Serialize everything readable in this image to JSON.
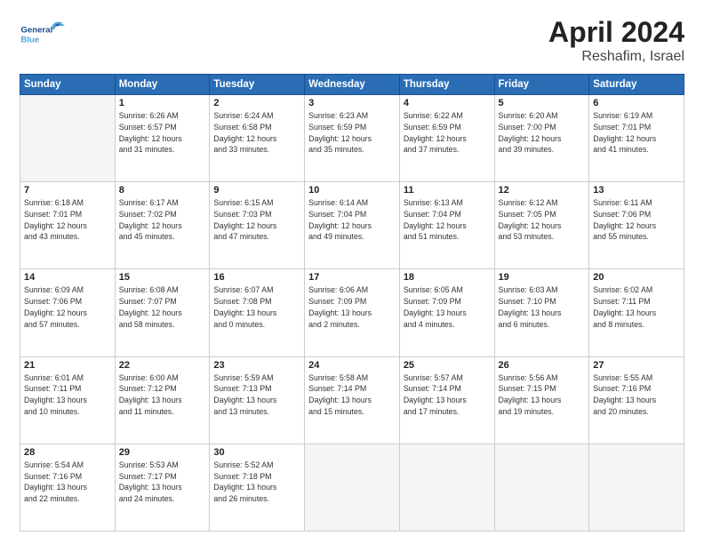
{
  "header": {
    "logo_line1": "General",
    "logo_line2": "Blue",
    "title": "April 2024",
    "subtitle": "Reshafim, Israel"
  },
  "weekdays": [
    "Sunday",
    "Monday",
    "Tuesday",
    "Wednesday",
    "Thursday",
    "Friday",
    "Saturday"
  ],
  "weeks": [
    [
      {
        "day": "",
        "info": ""
      },
      {
        "day": "1",
        "info": "Sunrise: 6:26 AM\nSunset: 6:57 PM\nDaylight: 12 hours\nand 31 minutes."
      },
      {
        "day": "2",
        "info": "Sunrise: 6:24 AM\nSunset: 6:58 PM\nDaylight: 12 hours\nand 33 minutes."
      },
      {
        "day": "3",
        "info": "Sunrise: 6:23 AM\nSunset: 6:59 PM\nDaylight: 12 hours\nand 35 minutes."
      },
      {
        "day": "4",
        "info": "Sunrise: 6:22 AM\nSunset: 6:59 PM\nDaylight: 12 hours\nand 37 minutes."
      },
      {
        "day": "5",
        "info": "Sunrise: 6:20 AM\nSunset: 7:00 PM\nDaylight: 12 hours\nand 39 minutes."
      },
      {
        "day": "6",
        "info": "Sunrise: 6:19 AM\nSunset: 7:01 PM\nDaylight: 12 hours\nand 41 minutes."
      }
    ],
    [
      {
        "day": "7",
        "info": "Sunrise: 6:18 AM\nSunset: 7:01 PM\nDaylight: 12 hours\nand 43 minutes."
      },
      {
        "day": "8",
        "info": "Sunrise: 6:17 AM\nSunset: 7:02 PM\nDaylight: 12 hours\nand 45 minutes."
      },
      {
        "day": "9",
        "info": "Sunrise: 6:15 AM\nSunset: 7:03 PM\nDaylight: 12 hours\nand 47 minutes."
      },
      {
        "day": "10",
        "info": "Sunrise: 6:14 AM\nSunset: 7:04 PM\nDaylight: 12 hours\nand 49 minutes."
      },
      {
        "day": "11",
        "info": "Sunrise: 6:13 AM\nSunset: 7:04 PM\nDaylight: 12 hours\nand 51 minutes."
      },
      {
        "day": "12",
        "info": "Sunrise: 6:12 AM\nSunset: 7:05 PM\nDaylight: 12 hours\nand 53 minutes."
      },
      {
        "day": "13",
        "info": "Sunrise: 6:11 AM\nSunset: 7:06 PM\nDaylight: 12 hours\nand 55 minutes."
      }
    ],
    [
      {
        "day": "14",
        "info": "Sunrise: 6:09 AM\nSunset: 7:06 PM\nDaylight: 12 hours\nand 57 minutes."
      },
      {
        "day": "15",
        "info": "Sunrise: 6:08 AM\nSunset: 7:07 PM\nDaylight: 12 hours\nand 58 minutes."
      },
      {
        "day": "16",
        "info": "Sunrise: 6:07 AM\nSunset: 7:08 PM\nDaylight: 13 hours\nand 0 minutes."
      },
      {
        "day": "17",
        "info": "Sunrise: 6:06 AM\nSunset: 7:09 PM\nDaylight: 13 hours\nand 2 minutes."
      },
      {
        "day": "18",
        "info": "Sunrise: 6:05 AM\nSunset: 7:09 PM\nDaylight: 13 hours\nand 4 minutes."
      },
      {
        "day": "19",
        "info": "Sunrise: 6:03 AM\nSunset: 7:10 PM\nDaylight: 13 hours\nand 6 minutes."
      },
      {
        "day": "20",
        "info": "Sunrise: 6:02 AM\nSunset: 7:11 PM\nDaylight: 13 hours\nand 8 minutes."
      }
    ],
    [
      {
        "day": "21",
        "info": "Sunrise: 6:01 AM\nSunset: 7:11 PM\nDaylight: 13 hours\nand 10 minutes."
      },
      {
        "day": "22",
        "info": "Sunrise: 6:00 AM\nSunset: 7:12 PM\nDaylight: 13 hours\nand 11 minutes."
      },
      {
        "day": "23",
        "info": "Sunrise: 5:59 AM\nSunset: 7:13 PM\nDaylight: 13 hours\nand 13 minutes."
      },
      {
        "day": "24",
        "info": "Sunrise: 5:58 AM\nSunset: 7:14 PM\nDaylight: 13 hours\nand 15 minutes."
      },
      {
        "day": "25",
        "info": "Sunrise: 5:57 AM\nSunset: 7:14 PM\nDaylight: 13 hours\nand 17 minutes."
      },
      {
        "day": "26",
        "info": "Sunrise: 5:56 AM\nSunset: 7:15 PM\nDaylight: 13 hours\nand 19 minutes."
      },
      {
        "day": "27",
        "info": "Sunrise: 5:55 AM\nSunset: 7:16 PM\nDaylight: 13 hours\nand 20 minutes."
      }
    ],
    [
      {
        "day": "28",
        "info": "Sunrise: 5:54 AM\nSunset: 7:16 PM\nDaylight: 13 hours\nand 22 minutes."
      },
      {
        "day": "29",
        "info": "Sunrise: 5:53 AM\nSunset: 7:17 PM\nDaylight: 13 hours\nand 24 minutes."
      },
      {
        "day": "30",
        "info": "Sunrise: 5:52 AM\nSunset: 7:18 PM\nDaylight: 13 hours\nand 26 minutes."
      },
      {
        "day": "",
        "info": ""
      },
      {
        "day": "",
        "info": ""
      },
      {
        "day": "",
        "info": ""
      },
      {
        "day": "",
        "info": ""
      }
    ]
  ]
}
